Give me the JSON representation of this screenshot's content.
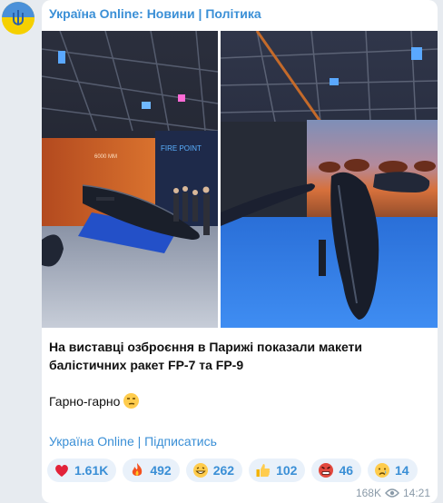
{
  "channel": {
    "name": "Україна Online: Новини | Політика"
  },
  "post": {
    "headline": "На виставці озброєння в Парижі показали макети балістичних ракет FP-7 та FP-9",
    "comment": "Гарно-гарно",
    "signature": "Україна Online | Підписатись"
  },
  "photos": [
    {
      "name": "left-photo",
      "sign": "FIRE POINT",
      "range": "6000 MM"
    },
    {
      "name": "right-photo"
    }
  ],
  "reactions": [
    {
      "icon": "heart-icon",
      "count": "1.61K"
    },
    {
      "icon": "fire-icon",
      "count": "492"
    },
    {
      "icon": "grin-face-icon",
      "count": "262"
    },
    {
      "icon": "thumbs-up-icon",
      "count": "102"
    },
    {
      "icon": "angry-face-icon",
      "count": "46"
    },
    {
      "icon": "crying-face-icon",
      "count": "14"
    }
  ],
  "meta": {
    "views": "168K",
    "time": "14:21"
  },
  "colors": {
    "accent": "#3a8fd6",
    "bubble": "#ffffff",
    "background": "#e7ebf0"
  }
}
